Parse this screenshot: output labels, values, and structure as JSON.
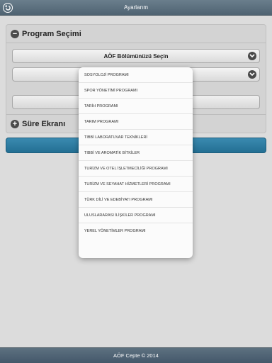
{
  "header": {
    "title": "Ayarlarım",
    "back_icon": "back-arrow-icon"
  },
  "program_section": {
    "title": "Program Seçimi",
    "toggle_symbol": "−",
    "department_select": {
      "value": "AÖF Bölümünüzü Seçin"
    },
    "program_select": {
      "value": ""
    }
  },
  "duration_section": {
    "title": "Süre Ekranı",
    "toggle_symbol": "+"
  },
  "dropdown": {
    "options": [
      "SOSYOLOJİ PROGRAMI",
      "SPOR YÖNETİMİ PROGRAMI",
      "TARİH PROGRAMI",
      "TARIM PROGRAMI",
      "TIBBİ LABORATUVAR TEKNİKLERİ",
      "TIBBİ VE AROMATİK BİTKİLER",
      "TURİZM VE OTEL İŞLETMECİLİĞİ PROGRAMI",
      "TURİZM VE SEYAHAT HİZMETLERİ PROGRAMI",
      "TÜRK DİLİ VE EDEBİYATI PROGRAMI",
      "ULUSLARARASI İLİŞKİLER PROGRAMI",
      "YEREL YÖNETİMLER PROGRAMI"
    ]
  },
  "footer": {
    "text": "AÖF Cepte © 2014"
  },
  "colors": {
    "topbar": "#5a6e7d",
    "accent_button": "#2b7ca3",
    "background": "#dcdcdc"
  }
}
